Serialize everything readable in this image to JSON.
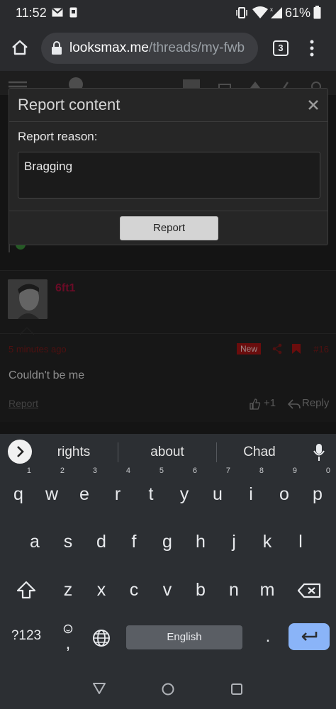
{
  "status_bar": {
    "time": "11:52",
    "battery": "61%"
  },
  "browser": {
    "url_host": "looksmax.me",
    "url_path": "/threads/my-fwb",
    "tab_count": "3"
  },
  "modal": {
    "title": "Report content",
    "reason_label": "Report reason:",
    "reason_value": "Bragging",
    "submit_label": "Report"
  },
  "post": {
    "username": "6ft1",
    "time": "5 minutes ago",
    "new_badge": "New",
    "post_number": "#16",
    "body": "Couldn't be me",
    "report_link": "Report",
    "like_count": "+1",
    "reply_label": "Reply"
  },
  "keyboard": {
    "suggestions": [
      "rights",
      "about",
      "Chad"
    ],
    "row1": [
      {
        "k": "q",
        "h": "1"
      },
      {
        "k": "w",
        "h": "2"
      },
      {
        "k": "e",
        "h": "3"
      },
      {
        "k": "r",
        "h": "4"
      },
      {
        "k": "t",
        "h": "5"
      },
      {
        "k": "y",
        "h": "6"
      },
      {
        "k": "u",
        "h": "7"
      },
      {
        "k": "i",
        "h": "8"
      },
      {
        "k": "o",
        "h": "9"
      },
      {
        "k": "p",
        "h": "0"
      }
    ],
    "row2": [
      "a",
      "s",
      "d",
      "f",
      "g",
      "h",
      "j",
      "k",
      "l"
    ],
    "row3": [
      "z",
      "x",
      "c",
      "v",
      "b",
      "n",
      "m"
    ],
    "symbols_label": "?123",
    "comma_label": ",",
    "space_label": "English",
    "period_label": "."
  },
  "colors": {
    "accent": "#a3123b",
    "enter_key": "#8ab4f8",
    "new_badge": "#a31515"
  }
}
